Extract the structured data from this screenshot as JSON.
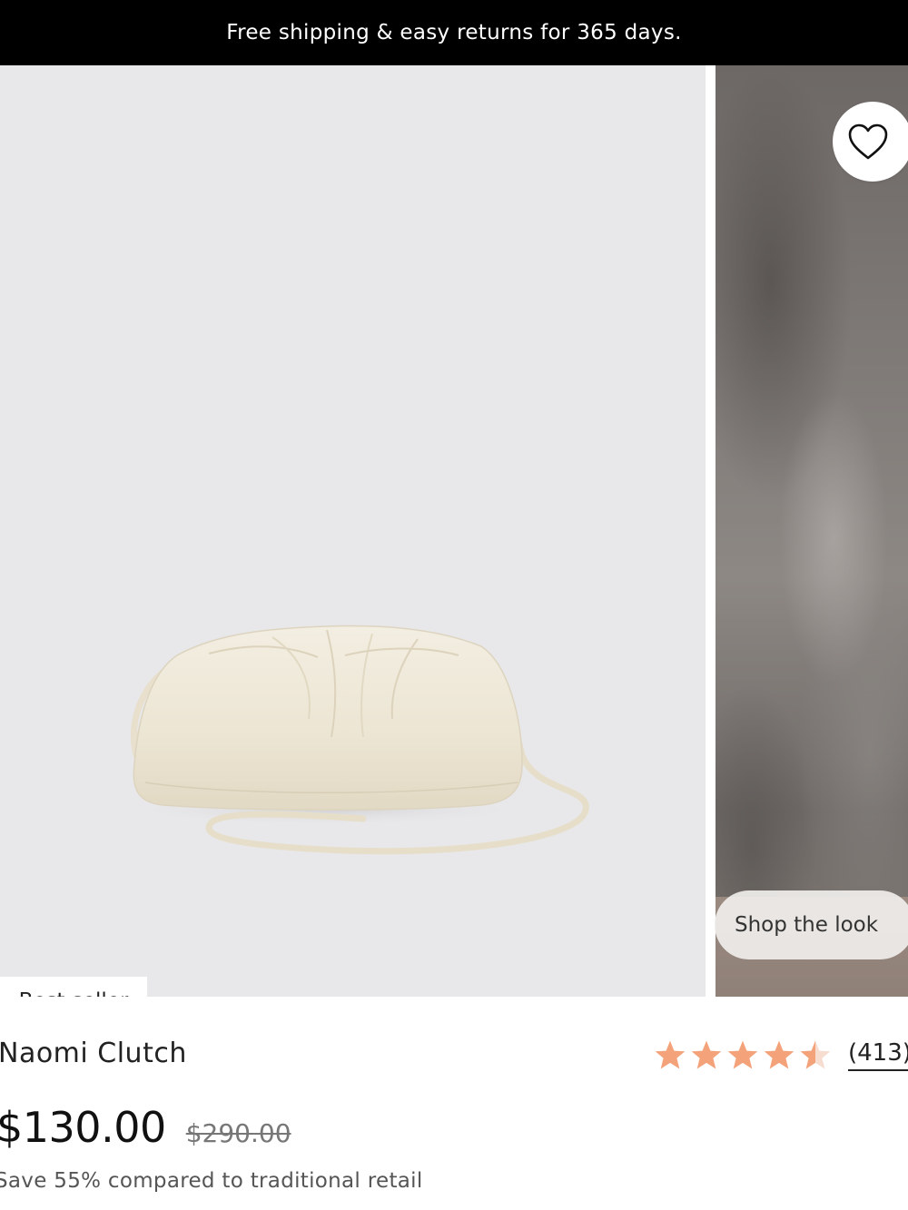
{
  "promo": {
    "text": "Free shipping & easy returns for 365 days."
  },
  "gallery": {
    "badge": "Best seller",
    "shop_the_look": "Shop the look",
    "wishlist_icon": "heart-outline-icon"
  },
  "product": {
    "name": "Naomi Clutch",
    "price": "$130.00",
    "compare_at_price": "$290.00",
    "savings_text": "Save 55% compared to traditional retail",
    "rating": 4.5,
    "review_count": "(413)"
  },
  "colors": {
    "star": "#f4a27a",
    "promo_bg": "#000000",
    "image_bg": "#e8e8ea",
    "bag": "#efe9da"
  }
}
